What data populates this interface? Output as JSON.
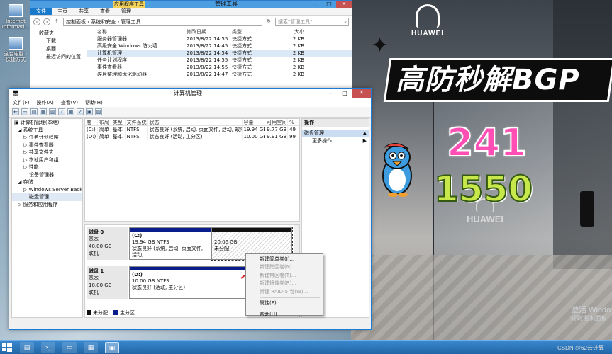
{
  "desktop": {
    "icons": [
      {
        "label": "Internet Informati..."
      },
      {
        "label": "这台电脑 - 快捷方式"
      }
    ]
  },
  "explorer": {
    "title": "管理工具",
    "tool_tab": "应用程序工具",
    "manage_tab": "管理",
    "ribbon_tabs": [
      "文件",
      "主页",
      "共享",
      "查看"
    ],
    "address": "控制面板 › 系统和安全 › 管理工具",
    "search_placeholder": "搜索\"管理工具\"",
    "nav": [
      "收藏夹",
      "下载",
      "桌面",
      "最近访问的位置"
    ],
    "columns": [
      "名称",
      "修改日期",
      "类型",
      "大小"
    ],
    "rows": [
      {
        "name": "服务器管理器",
        "date": "2013/8/22 14:55",
        "type": "快捷方式",
        "size": "2 KB"
      },
      {
        "name": "高级安全 Windows 防火墙",
        "date": "2013/8/22 14:45",
        "type": "快捷方式",
        "size": "2 KB"
      },
      {
        "name": "计算机管理",
        "date": "2013/8/22 14:54",
        "type": "快捷方式",
        "size": "2 KB"
      },
      {
        "name": "任务计划程序",
        "date": "2013/8/22 14:55",
        "type": "快捷方式",
        "size": "2 KB"
      },
      {
        "name": "事件查看器",
        "date": "2013/8/22 14:55",
        "type": "快捷方式",
        "size": "2 KB"
      },
      {
        "name": "碎片整理和优化驱动器",
        "date": "2013/8/22 14:47",
        "type": "快捷方式",
        "size": "2 KB"
      }
    ]
  },
  "cm": {
    "title": "计算机管理",
    "menu": [
      "文件(F)",
      "操作(A)",
      "查看(V)",
      "帮助(H)"
    ],
    "tree": [
      "计算机管理(本地)",
      "系统工具",
      "任务计划程序",
      "事件查看器",
      "共享文件夹",
      "本地用户和组",
      "性能",
      "设备管理器",
      "存储",
      "Windows Server Back",
      "磁盘管理",
      "服务和应用程序"
    ],
    "vol_columns": [
      "卷",
      "布局",
      "类型",
      "文件系统",
      "状态",
      "容量",
      "可用空间",
      "%"
    ],
    "volumes": [
      {
        "vol": "(C:)",
        "layout": "简单",
        "type": "基本",
        "fs": "NTFS",
        "status": "状态良好 (系统, 启动, 页面文件, 活动, 故障转储, 主分区)",
        "cap": "19.94 GB",
        "free": "9.77 GB",
        "pct": "49"
      },
      {
        "vol": "(D:)",
        "layout": "简单",
        "type": "基本",
        "fs": "NTFS",
        "status": "状态良好 (活动, 主分区)",
        "cap": "10.00 GB",
        "free": "9.91 GB",
        "pct": "99"
      }
    ],
    "disks": [
      {
        "name": "磁盘 0",
        "kind": "基本",
        "size": "40.00 GB",
        "state": "联机",
        "parts": [
          {
            "title": "(C:)",
            "size": "19.94 GB NTFS",
            "status": "状态良好 (系统, 启动, 页面文件, 活动,"
          },
          {
            "title": "",
            "size": "20.06 GB",
            "status": "未分配"
          }
        ]
      },
      {
        "name": "磁盘 1",
        "kind": "基本",
        "size": "10.00 GB",
        "state": "联机",
        "parts": [
          {
            "title": "(D:)",
            "size": "10.00 GB NTFS",
            "status": "状态良好 (活动, 主分区)"
          }
        ]
      }
    ],
    "legend": [
      "未分配",
      "主分区"
    ],
    "actions_header": "操作",
    "actions_group": "磁盘管理",
    "actions_more": "更多操作"
  },
  "context_menu": {
    "items": [
      {
        "label": "新建简单卷(I)...",
        "enabled": true
      },
      {
        "label": "新建跨区卷(N)...",
        "enabled": false
      },
      {
        "label": "新建带区卷(T)...",
        "enabled": false
      },
      {
        "label": "新建镜像卷(R)...",
        "enabled": false
      },
      {
        "label": "新建 RAID-5 卷(W)...",
        "enabled": false
      },
      {
        "label": "属性(P)",
        "enabled": true
      },
      {
        "label": "帮助(H)",
        "enabled": true
      }
    ]
  },
  "overlay": {
    "headline": "高防秒解BGP",
    "number1": "241",
    "number2": "1550",
    "brand": "HUAWEI",
    "activate_line1": "激活 Windo",
    "activate_line2": "转到\"控制面板",
    "csdn": "CSDN @62云计算"
  },
  "taskbar": {
    "items": [
      "explorer",
      "powershell",
      "file-explorer",
      "network",
      "computer-management"
    ]
  }
}
